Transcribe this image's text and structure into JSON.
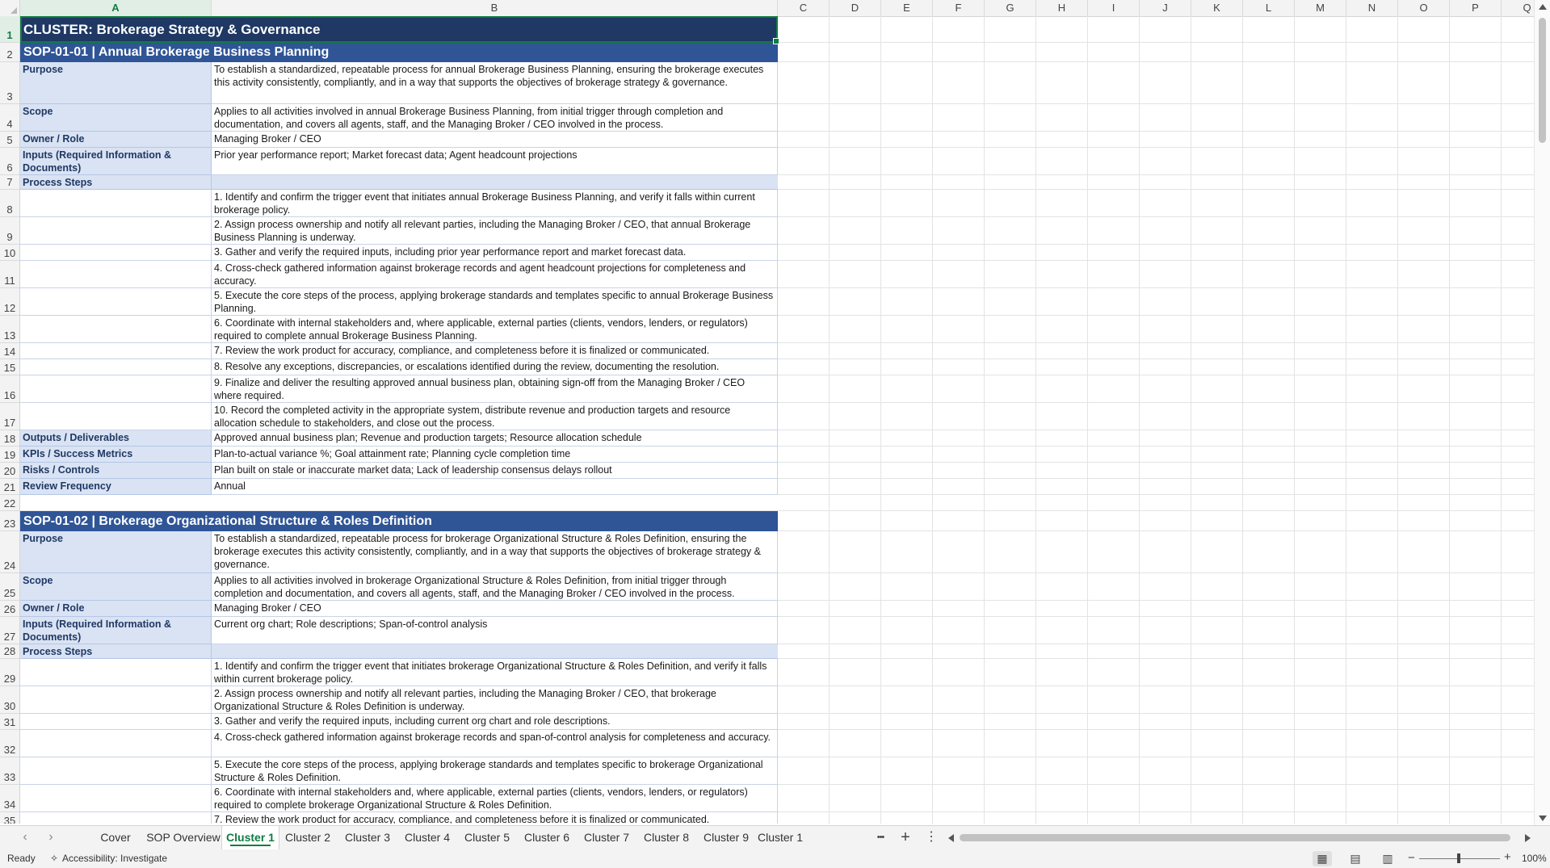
{
  "columns": [
    "A",
    "B",
    "C",
    "D",
    "E",
    "F",
    "G",
    "H",
    "I",
    "J",
    "K",
    "L",
    "M",
    "N",
    "O",
    "P",
    "Q"
  ],
  "selected_column": "A",
  "selected_row": 1,
  "rows": [
    {
      "n": 1,
      "type": "cluster",
      "text": "CLUSTER: Brokerage Strategy & Governance"
    },
    {
      "n": 2,
      "type": "sop",
      "text": "SOP-01-01  |  Annual Brokerage Business Planning"
    },
    {
      "n": 3,
      "type": "field",
      "label": "Purpose",
      "value": "To establish a standardized, repeatable process for annual Brokerage Business Planning, ensuring the brokerage executes this activity consistently, compliantly, and in a way that supports the objectives of brokerage strategy & governance."
    },
    {
      "n": 4,
      "type": "field",
      "label": "Scope",
      "value": "Applies to all activities involved in annual Brokerage Business Planning, from initial trigger through completion and documentation, and covers all agents, staff, and the Managing Broker / CEO involved in the process."
    },
    {
      "n": 5,
      "type": "field",
      "label": "Owner / Role",
      "value": "Managing Broker / CEO"
    },
    {
      "n": 6,
      "type": "field",
      "label": "Inputs (Required Information & Documents)",
      "value": "Prior year performance report; Market forecast data; Agent headcount projections"
    },
    {
      "n": 7,
      "type": "band",
      "label": "Process Steps"
    },
    {
      "n": 8,
      "type": "step",
      "value": "1. Identify and confirm the trigger event that initiates annual Brokerage Business Planning, and verify it falls within current brokerage policy."
    },
    {
      "n": 9,
      "type": "step",
      "value": "2. Assign process ownership and notify all relevant parties, including the Managing Broker / CEO, that annual Brokerage Business Planning is underway."
    },
    {
      "n": 10,
      "type": "step",
      "value": "3. Gather and verify the required inputs, including prior year performance report and market forecast data."
    },
    {
      "n": 11,
      "type": "step",
      "value": "4. Cross-check gathered information against brokerage records and agent headcount projections for completeness and accuracy."
    },
    {
      "n": 12,
      "type": "step",
      "value": "5. Execute the core steps of the process, applying brokerage standards and templates specific to annual Brokerage Business Planning."
    },
    {
      "n": 13,
      "type": "step",
      "value": "6. Coordinate with internal stakeholders and, where applicable, external parties (clients, vendors, lenders, or regulators) required to complete annual Brokerage Business Planning."
    },
    {
      "n": 14,
      "type": "step",
      "value": "7. Review the work product for accuracy, compliance, and completeness before it is finalized or communicated."
    },
    {
      "n": 15,
      "type": "step",
      "value": "8. Resolve any exceptions, discrepancies, or escalations identified during the review, documenting the resolution."
    },
    {
      "n": 16,
      "type": "step",
      "value": "9. Finalize and deliver the resulting approved annual business plan, obtaining sign-off from the Managing Broker / CEO where required."
    },
    {
      "n": 17,
      "type": "step",
      "value": "10. Record the completed activity in the appropriate system, distribute revenue and production targets and resource allocation schedule to stakeholders, and close out the process."
    },
    {
      "n": 18,
      "type": "field",
      "label": "Outputs / Deliverables",
      "value": "Approved annual business plan; Revenue and production targets; Resource allocation schedule"
    },
    {
      "n": 19,
      "type": "field",
      "label": "KPIs / Success Metrics",
      "value": "Plan-to-actual variance %; Goal attainment rate; Planning cycle completion time"
    },
    {
      "n": 20,
      "type": "field",
      "label": "Risks / Controls",
      "value": "Plan built on stale or inaccurate market data; Lack of leadership consensus delays rollout"
    },
    {
      "n": 21,
      "type": "field",
      "label": "Review Frequency",
      "value": "Annual"
    },
    {
      "n": 22,
      "type": "empty"
    },
    {
      "n": 23,
      "type": "sop",
      "text": "SOP-01-02  |  Brokerage Organizational Structure & Roles Definition"
    },
    {
      "n": 24,
      "type": "field",
      "label": "Purpose",
      "value": "To establish a standardized, repeatable process for brokerage Organizational Structure & Roles Definition, ensuring the brokerage executes this activity consistently, compliantly, and in a way that supports the objectives of brokerage strategy & governance."
    },
    {
      "n": 25,
      "type": "field",
      "label": "Scope",
      "value": "Applies to all activities involved in brokerage Organizational Structure & Roles Definition, from initial trigger through completion and documentation, and covers all agents, staff, and the Managing Broker / CEO involved in the process."
    },
    {
      "n": 26,
      "type": "field",
      "label": "Owner / Role",
      "value": "Managing Broker / CEO"
    },
    {
      "n": 27,
      "type": "field",
      "label": "Inputs (Required Information & Documents)",
      "value": "Current org chart; Role descriptions; Span-of-control analysis"
    },
    {
      "n": 28,
      "type": "band",
      "label": "Process Steps"
    },
    {
      "n": 29,
      "type": "step",
      "value": "1. Identify and confirm the trigger event that initiates brokerage Organizational Structure & Roles Definition, and verify it falls within current brokerage policy."
    },
    {
      "n": 30,
      "type": "step",
      "value": "2. Assign process ownership and notify all relevant parties, including the Managing Broker / CEO, that brokerage Organizational Structure & Roles Definition is underway."
    },
    {
      "n": 31,
      "type": "step",
      "value": "3. Gather and verify the required inputs, including current org chart and role descriptions."
    },
    {
      "n": 32,
      "type": "step",
      "value": "4. Cross-check gathered information against brokerage records and span-of-control analysis for completeness and accuracy."
    },
    {
      "n": 33,
      "type": "step",
      "value": "5. Execute the core steps of the process, applying brokerage standards and templates specific to brokerage Organizational Structure & Roles Definition."
    },
    {
      "n": 34,
      "type": "step",
      "value": "6. Coordinate with internal stakeholders and, where applicable, external parties (clients, vendors, lenders, or regulators) required to complete brokerage Organizational Structure & Roles Definition."
    },
    {
      "n": 35,
      "type": "step",
      "value": "7. Review the work product for accuracy, compliance, and completeness before it is finalized or communicated."
    }
  ],
  "sheet_tabs": [
    {
      "label": "Cover",
      "active": false
    },
    {
      "label": "SOP Overview",
      "active": false
    },
    {
      "label": "Cluster 1",
      "active": true
    },
    {
      "label": "Cluster 2",
      "active": false
    },
    {
      "label": "Cluster 3",
      "active": false
    },
    {
      "label": "Cluster 4",
      "active": false
    },
    {
      "label": "Cluster 5",
      "active": false
    },
    {
      "label": "Cluster 6",
      "active": false
    },
    {
      "label": "Cluster 7",
      "active": false
    },
    {
      "label": "Cluster 8",
      "active": false
    },
    {
      "label": "Cluster 9",
      "active": false
    },
    {
      "label": "Cluster 1",
      "active": false
    }
  ],
  "tabbar": {
    "more": "•••",
    "add": "+",
    "options": "⋮",
    "prev": "‹",
    "next": "›"
  },
  "status": {
    "ready": "Ready",
    "accessibility": "Accessibility: Investigate",
    "zoom": "100%"
  },
  "icons": {
    "accessibility": "accessibility-icon",
    "normal_view": "grid-icon",
    "page_layout": "page-layout-icon",
    "page_break": "page-break-icon"
  },
  "colors": {
    "cluster_bg": "#1f3864",
    "sop_bg": "#2f5597",
    "label_bg": "#dae3f3",
    "label_text": "#1f3864",
    "accent": "#107c41"
  }
}
